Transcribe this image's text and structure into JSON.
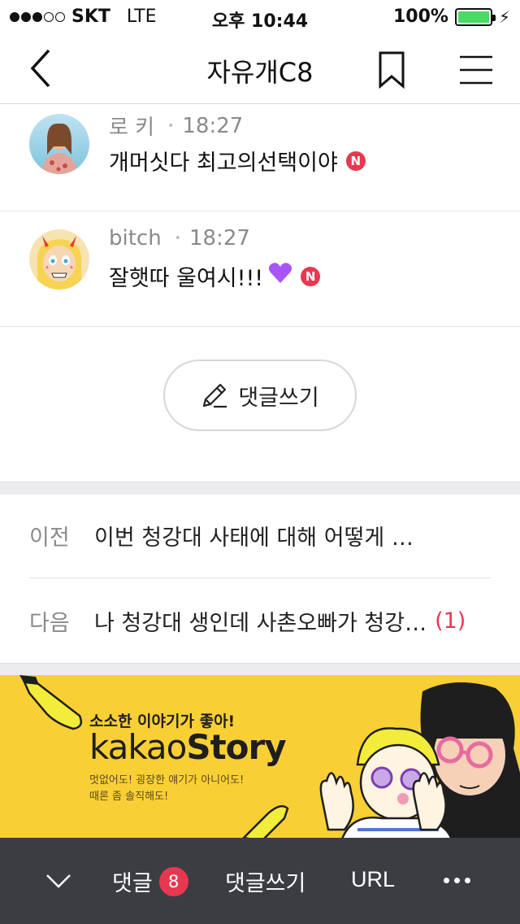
{
  "status_bar": {
    "carrier": "SKT",
    "network": "LTE",
    "time": "오후 10:44",
    "battery": "100%",
    "signal_strength": 3,
    "signal_max": 5
  },
  "nav": {
    "title": "자유개C8",
    "back_icon": "chevron-left-icon",
    "bookmark_icon": "bookmark-icon",
    "menu_icon": "hamburger-menu-icon"
  },
  "comments": [
    {
      "author": "로 키",
      "time": "18:27",
      "text": "개머싯다 최고의선택이야",
      "emoji": "",
      "badge": "N"
    },
    {
      "author": "bitch",
      "time": "18:27",
      "text": "잘햇따 울여시!!!",
      "emoji": "💜",
      "badge": "N"
    }
  ],
  "write_button": {
    "label": "댓글쓰기",
    "icon": "pencil-icon"
  },
  "prev_next": {
    "prev_label": "이전",
    "prev_title": "이번 청강대 사태에 대해 어떻게 …",
    "next_label": "다음",
    "next_title": "나 청강대 생인데 사촌오빠가 청강…",
    "next_count": "(1)"
  },
  "ad": {
    "tagline": "소소한 이야기가 좋아!",
    "brand_light": "kakao",
    "brand_bold": "Story",
    "sub1": "멋없어도! 굉장한 얘기가 아니어도!",
    "sub2": "때론 좀 솔직해도!"
  },
  "toolbar": {
    "comments_label": "댓글",
    "comments_count": "8",
    "write_label": "댓글쓰기",
    "url_label": "URL"
  },
  "colors": {
    "accent_red": "#e8384f",
    "toolbar_bg": "#3c3d43",
    "ad_yellow": "#f9cf36",
    "battery_green": "#4cd964"
  }
}
